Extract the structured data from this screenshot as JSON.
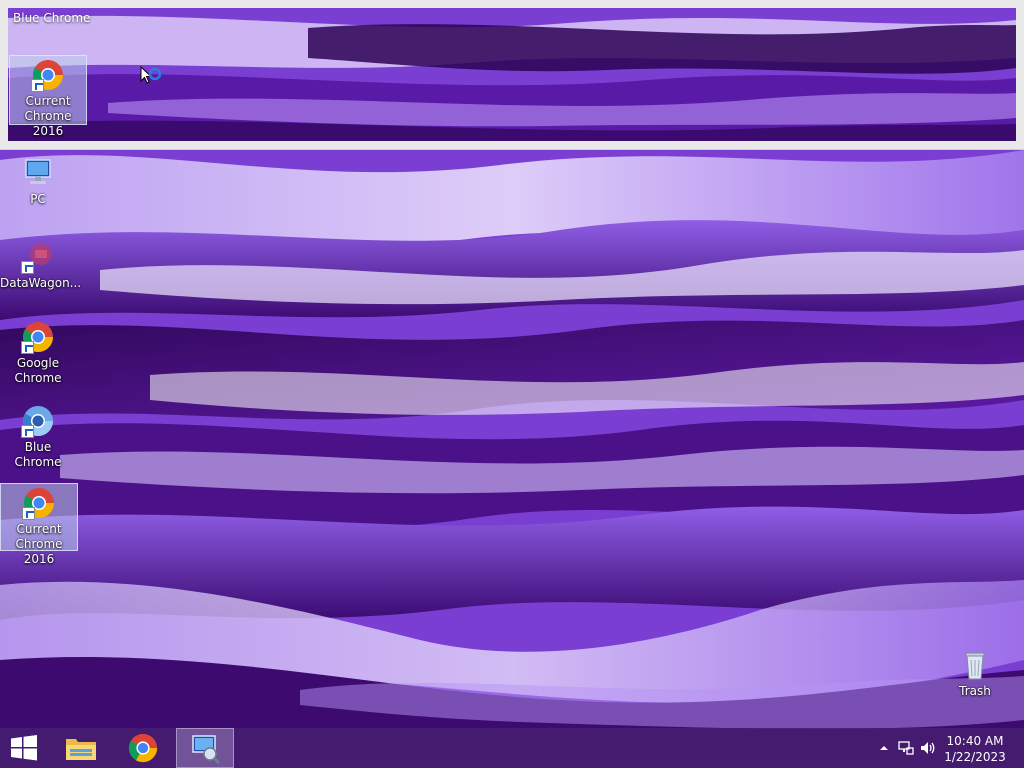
{
  "thumbnail_popup": {
    "title": "Blue Chrome",
    "icon_label": "Current\nChrome 2016"
  },
  "desktop_icons": [
    {
      "label": "PC",
      "icon": "computer-icon"
    },
    {
      "label": "DataWagon...",
      "icon": "datawagon-icon"
    },
    {
      "label": "Google\nChrome",
      "icon": "chrome-icon"
    },
    {
      "label": "Blue Chrome",
      "icon": "blue-chrome-icon"
    },
    {
      "label": "Current\nChrome 2016",
      "icon": "chrome-icon"
    },
    {
      "label": "Trash",
      "icon": "recycle-bin-icon"
    }
  ],
  "taskbar": {
    "items": [
      "start-icon",
      "file-explorer-icon",
      "chrome-icon",
      "remote-desktop-icon"
    ],
    "clock": {
      "time": "10:40 AM",
      "date": "1/22/2023"
    },
    "tray": [
      "show-hidden-icons-chevron",
      "network-icon",
      "volume-icon"
    ]
  },
  "colors": {
    "wallpaper_base": "#7b3fd0",
    "taskbar": "#461e6e",
    "selection": "#becdeb"
  }
}
